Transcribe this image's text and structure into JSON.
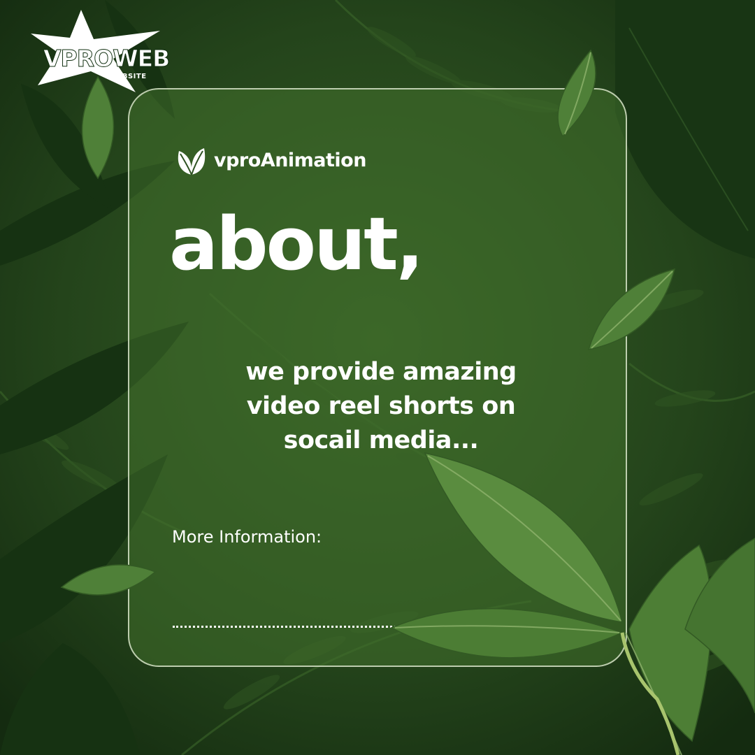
{
  "brand": {
    "logo_text": "VPROWEB",
    "logo_subtext": "WEBSITE",
    "name": "vproAnimation",
    "leaf_icon": "leaf-icon"
  },
  "headline": "about,",
  "tagline_lines": [
    "we provide amazing",
    "video reel shorts on",
    "socail media..."
  ],
  "more_info_label": "More Information:",
  "colors": {
    "background": "#1f3a18",
    "card": "#42702c",
    "text": "#ffffff"
  }
}
